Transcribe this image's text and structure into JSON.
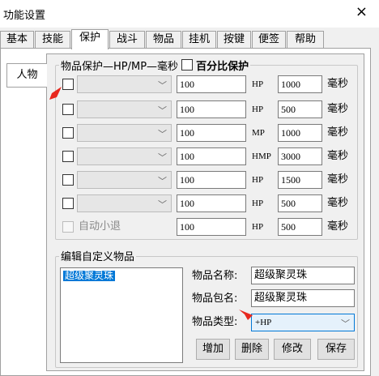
{
  "window": {
    "title": "功能设置",
    "close_glyph": "×"
  },
  "tabs": [
    "基本",
    "技能",
    "保护",
    "战斗",
    "物品",
    "挂机",
    "按键",
    "便签",
    "帮助"
  ],
  "active_tab": "保护",
  "subtab": {
    "label": "人物"
  },
  "protect": {
    "group_label": "物品保护—HP/MP—毫秒",
    "percent_label": "百分比保护",
    "rows": [
      {
        "value": "100",
        "unit": "HP",
        "ms": "1000",
        "ms_label": "毫秒"
      },
      {
        "value": "100",
        "unit": "HP",
        "ms": "500",
        "ms_label": "毫秒"
      },
      {
        "value": "100",
        "unit": "MP",
        "ms": "1000",
        "ms_label": "毫秒"
      },
      {
        "value": "100",
        "unit": "HMP",
        "ms": "3000",
        "ms_label": "毫秒"
      },
      {
        "value": "100",
        "unit": "HP",
        "ms": "1500",
        "ms_label": "毫秒"
      },
      {
        "value": "100",
        "unit": "HP",
        "ms": "500",
        "ms_label": "毫秒"
      }
    ],
    "auto": {
      "label": "自动小退",
      "value": "100",
      "unit": "HP",
      "ms": "500",
      "ms_label": "毫秒"
    }
  },
  "custom": {
    "group_label": "编辑自定义物品",
    "list": [
      "超级聚灵珠"
    ],
    "name_label": "物品名称:",
    "name_value": "超级聚灵珠",
    "pkg_label": "物品包名:",
    "pkg_value": "超级聚灵珠",
    "type_label": "物品类型:",
    "type_value": "+HP",
    "buttons": {
      "add": "增加",
      "delete": "删除",
      "modify": "修改",
      "save": "保存"
    }
  },
  "colors": {
    "selection": "#0078d7",
    "arrow": "#e8281e"
  }
}
